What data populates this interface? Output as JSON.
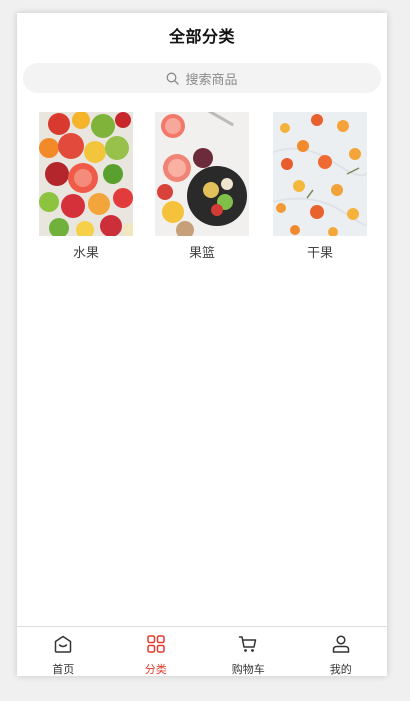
{
  "header": {
    "title": "全部分类"
  },
  "search": {
    "placeholder": "搜索商品"
  },
  "categories": [
    {
      "label": "水果"
    },
    {
      "label": "果篮"
    },
    {
      "label": "干果"
    }
  ],
  "tabbar": {
    "active_color": "#e23c2e",
    "items": [
      {
        "label": "首页",
        "icon": "home-icon"
      },
      {
        "label": "分类",
        "icon": "category-grid-icon"
      },
      {
        "label": "购物车",
        "icon": "cart-icon"
      },
      {
        "label": "我的",
        "icon": "user-icon"
      }
    ]
  }
}
